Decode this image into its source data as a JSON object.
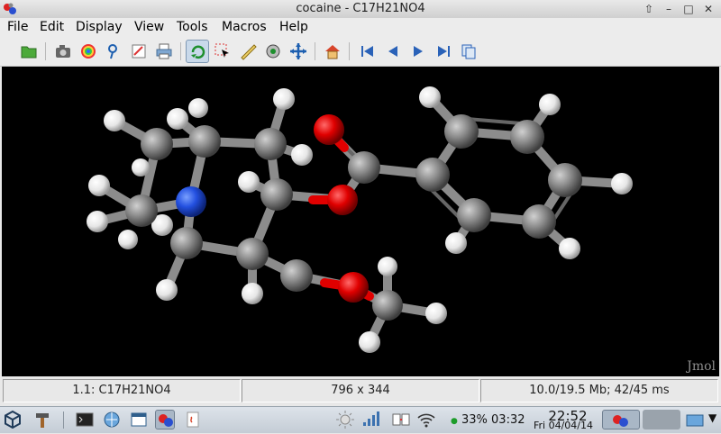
{
  "window": {
    "title": "cocaine - C17H21NO4"
  },
  "menu": [
    {
      "label": "File"
    },
    {
      "label": "Edit"
    },
    {
      "label": "Display"
    },
    {
      "label": "View"
    },
    {
      "label": "Tools"
    },
    {
      "label": "Macros"
    },
    {
      "label": "Help"
    }
  ],
  "toolbar": {
    "buttons": [
      "open-folder-icon",
      "camera-icon",
      "rainbow-icon",
      "pick-icon",
      "edit-icon",
      "print-icon",
      "rotate-icon",
      "select-icon",
      "ruler-icon",
      "spin-icon",
      "pan-icon",
      "home-icon",
      "first-frame-icon",
      "prev-frame-icon",
      "next-frame-icon",
      "last-frame-icon",
      "copy-frames-icon"
    ],
    "active": "rotate-icon"
  },
  "viewer": {
    "watermark": "Jmol",
    "background": "#000000"
  },
  "status": {
    "model": "1.1: C17H21NO4",
    "size": "796 x 344",
    "memory": "10.0/19.5 Mb;  42/45 ms"
  },
  "taskbar": {
    "battery": "33% 03:32",
    "time": "22:52",
    "date": "Fri 04/04/14"
  },
  "colors": {
    "carbon": "#8e8e8e",
    "hydrogen": "#f2f2f2",
    "nitrogen": "#2350e0",
    "oxygen": "#e00000"
  }
}
